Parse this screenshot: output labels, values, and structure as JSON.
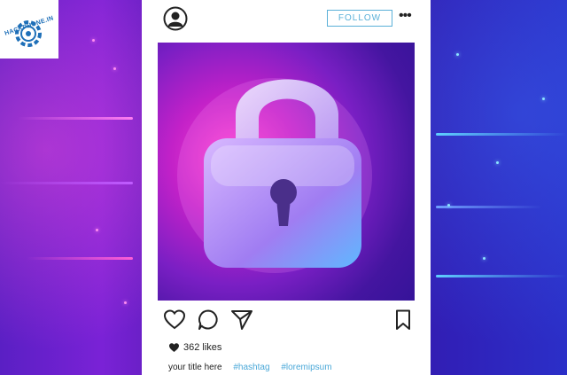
{
  "logo": {
    "text": "HACKPHONE.IN"
  },
  "post": {
    "follow_label": "FOLLOW",
    "more_label": "•••",
    "likes": "362 likes",
    "caption": {
      "title": "your title here",
      "hashtags": [
        "#hashtag",
        "#loremipsum"
      ]
    }
  },
  "colors": {
    "accent": "#5ab0d8",
    "hashtag": "#4aa8d8",
    "background": "#4a1aa8"
  },
  "icons": [
    "avatar-icon",
    "more-icon",
    "lock-icon",
    "heart-icon",
    "comment-icon",
    "share-icon",
    "bookmark-icon"
  ]
}
